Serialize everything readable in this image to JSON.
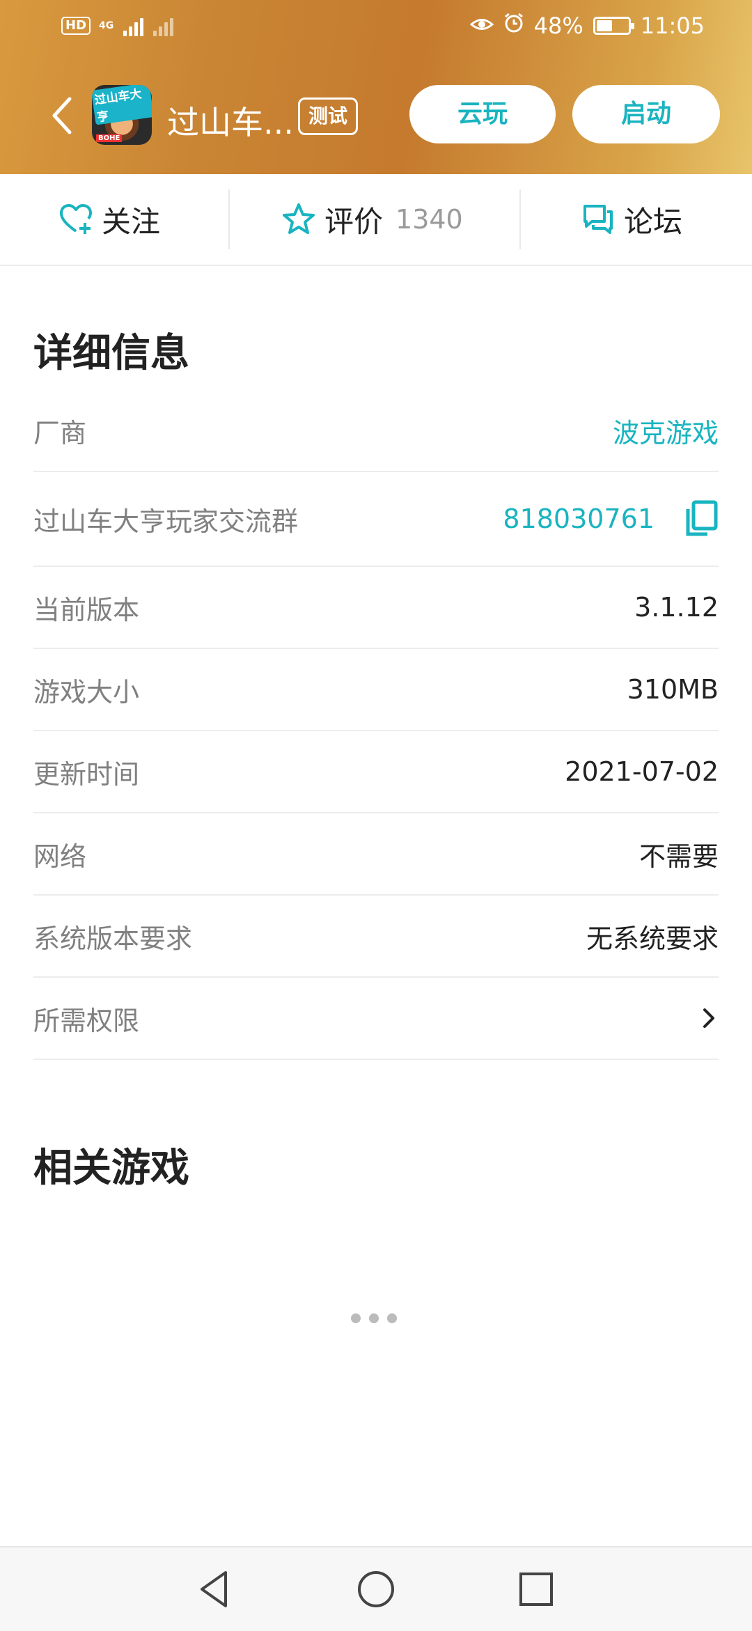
{
  "status_bar": {
    "hd_label": "HD",
    "network_label": "4G",
    "battery": "48%",
    "time": "11:05"
  },
  "app": {
    "icon_text": "过山车大亨",
    "icon_bottom_text": "BOHE",
    "title": "过山车...",
    "badge": "测试",
    "cloud_play_label": "云玩",
    "launch_label": "启动"
  },
  "actions": {
    "follow_label": "关注",
    "rate_label": "评价",
    "rate_count": "1340",
    "forum_label": "论坛"
  },
  "details": {
    "title": "详细信息",
    "rows": [
      {
        "key": "厂商",
        "value": "波克游戏"
      },
      {
        "key": "过山车大亨玩家交流群",
        "value": "818030761"
      },
      {
        "key": "当前版本",
        "value": "3.1.12"
      },
      {
        "key": "游戏大小",
        "value": "310MB"
      },
      {
        "key": "更新时间",
        "value": "2021-07-02"
      },
      {
        "key": "网络",
        "value": "不需要"
      },
      {
        "key": "系统版本要求",
        "value": "无系统要求"
      },
      {
        "key": "所需权限",
        "value": ""
      }
    ]
  },
  "related": {
    "title": "相关游戏"
  },
  "colors": {
    "accent": "#19b4c0",
    "header_start": "#d99a3e",
    "header_end": "#e8c46a"
  }
}
